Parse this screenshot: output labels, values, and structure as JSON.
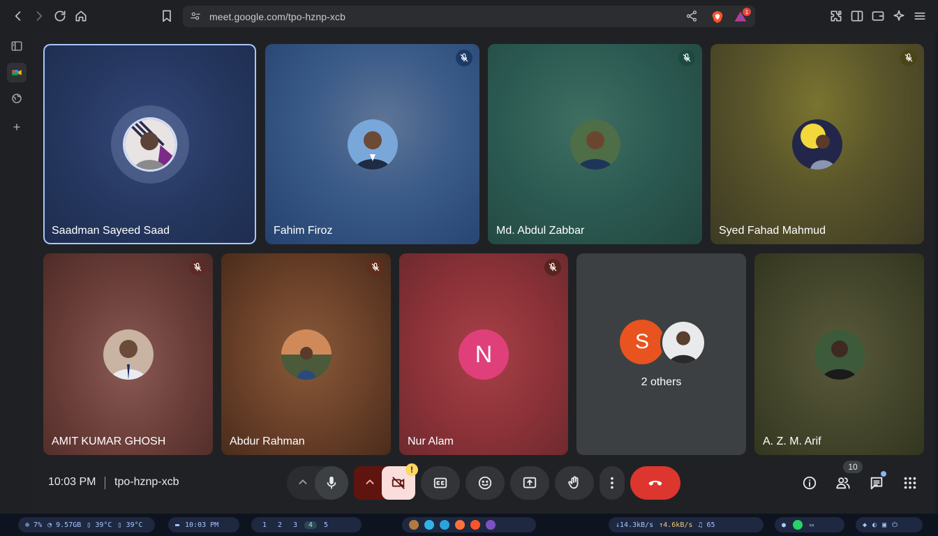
{
  "browser": {
    "url": "meet.google.com/tpo-hznp-xcb",
    "rewards_badge": "1"
  },
  "participants": [
    {
      "name": "Saadman Sayeed Saad",
      "muted": false,
      "speaking": true
    },
    {
      "name": "Fahim Firoz",
      "muted": true
    },
    {
      "name": "Md. Abdul Zabbar",
      "muted": true
    },
    {
      "name": "Syed Fahad Mahmud",
      "muted": true
    },
    {
      "name": "AMIT KUMAR GHOSH",
      "muted": true
    },
    {
      "name": "Abdur Rahman",
      "muted": true
    },
    {
      "name": "Nur Alam",
      "muted": true,
      "initial": "N"
    },
    {
      "name": "2 others",
      "initial": "S"
    },
    {
      "name": "A. Z. M. Arif",
      "muted": false
    }
  ],
  "footer": {
    "time": "10:03 PM",
    "meeting_code": "tpo-hznp-xcb",
    "people_count": "10",
    "camera_warning": "!"
  },
  "taskbar": {
    "cpu": "7%",
    "mem": "9.57GB",
    "temp1": "39°C",
    "temp2": "39°C",
    "clock": "10:03 PM",
    "workspaces": [
      "1",
      "2",
      "3",
      "4",
      "5"
    ],
    "active_workspace": "4",
    "down": "14.3kB/s",
    "up": "4.6kB/s",
    "volume": "65"
  }
}
